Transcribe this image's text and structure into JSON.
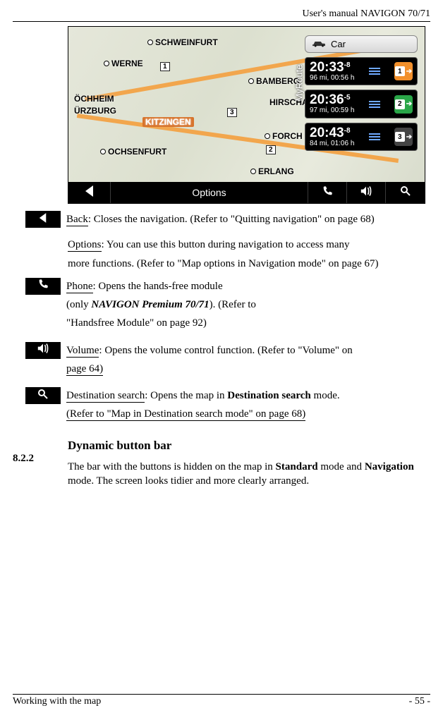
{
  "header": {
    "title": "User's manual NAVIGON 70/71"
  },
  "footer": {
    "left": "Working with the map",
    "right": "- 55 -"
  },
  "device": {
    "profile_label": "Car",
    "myroute_label": "MyRoute",
    "cities": {
      "schweinfurt": "SCHWEINFURT",
      "werne": "WERNE",
      "ochheim": "ÖCHHEIM",
      "urzburg": "ÜRZBURG",
      "kitzingen": "KITZINGEN",
      "ochsenfurt": "OCHSENFURT",
      "bamberg": "BAMBERG",
      "hirscha": "HIRSCHA",
      "forch": "FORCH",
      "erlang": "ERLANG"
    },
    "road_labels": {
      "r1": "1",
      "r2": "2",
      "r3": "3"
    },
    "routes": [
      {
        "time": "20:33",
        "frac": "-8",
        "detail": "96  mi, 00:56 h",
        "num": "1"
      },
      {
        "time": "20:36",
        "frac": "-5",
        "detail": "97  mi, 00:59 h",
        "num": "2"
      },
      {
        "time": "20:43",
        "frac": "-8",
        "detail": "84  mi, 01:06 h",
        "num": "3"
      }
    ],
    "toolbar": {
      "options": "Options"
    }
  },
  "rows": {
    "back": {
      "term": "Back",
      "rest": ": Closes the navigation. (Refer to \"Quitting navigation\" on page 68)"
    },
    "options": {
      "term": "Options",
      "rest_a": ": You can use this button during navigation to access many",
      "rest_b": "more functions. (Refer to \"Map options in Navigation mode\" on page 67)"
    },
    "phone": {
      "term": "Phone",
      "rest_a": ": Opens the hands-free module",
      "only": "(only ",
      "model": "NAVIGON Premium 70/71",
      "closeparen": "). (Refer to",
      "rest_c": "\"Handsfree Module\" on page 92)"
    },
    "volume": {
      "term": "Volume",
      "rest_a": ": Opens the volume control function. (Refer to \"Volume\" on",
      "rest_b": "page 64)"
    },
    "dest": {
      "term": "Destination search",
      "rest_a": ": Opens the map in ",
      "bold": "Destination search",
      "rest_b": " mode.",
      "rest_c": "(Refer to \"Map in Destination search mode\" on page 68)"
    }
  },
  "section": {
    "number": "8.2.2",
    "title": "Dynamic button bar",
    "p_a": "The bar with the buttons is hidden on the map in ",
    "p_b1": "Standard",
    "p_c": " mode and ",
    "p_b2": "Navigation",
    "p_d": " mode. The screen looks tidier and more clearly arranged."
  }
}
